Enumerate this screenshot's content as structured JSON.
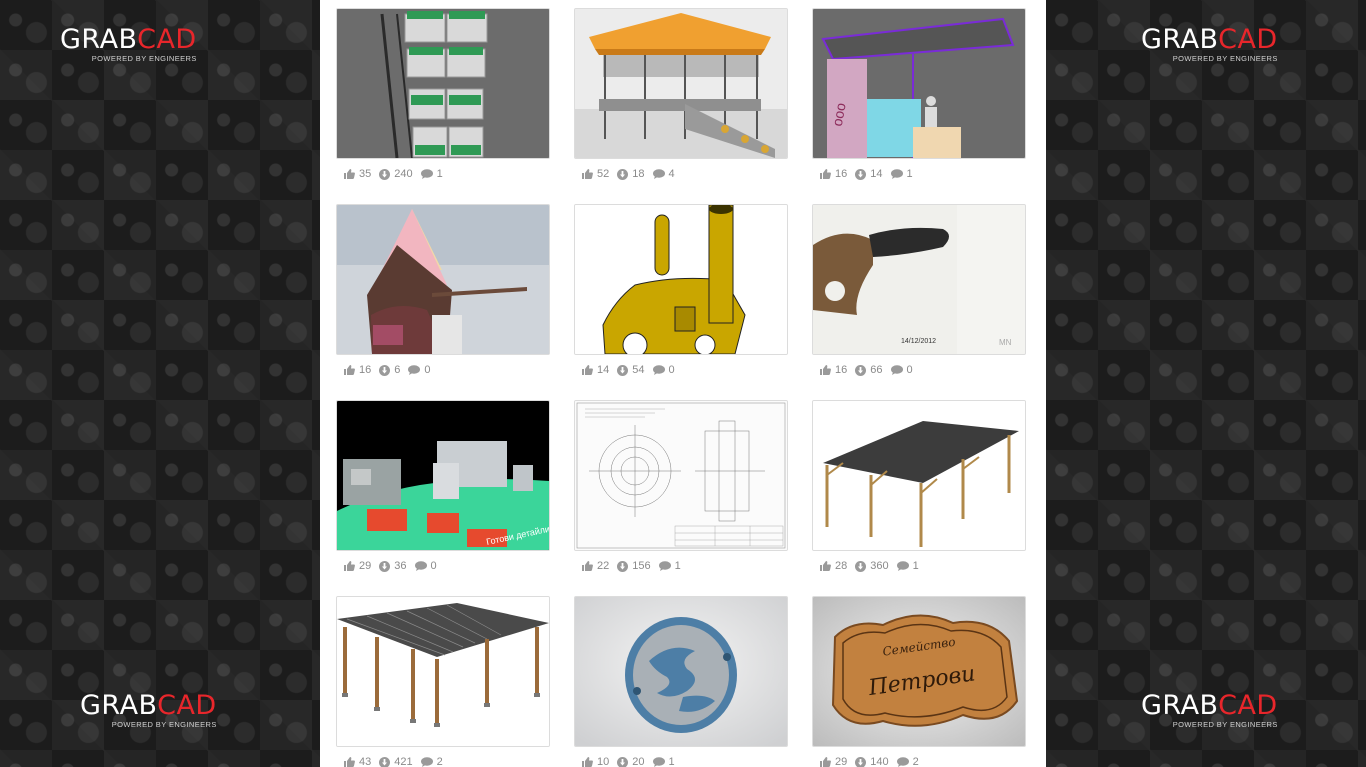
{
  "brand": {
    "word_main": "GRAB",
    "word_accent": "CAD",
    "tagline": "POWERED BY ENGINEERS",
    "accent_color": "#e8262b"
  },
  "models": [
    {
      "subject": "shelf-display-rack",
      "likes": "35",
      "downloads": "240",
      "comments": "1"
    },
    {
      "subject": "gazebo",
      "likes": "52",
      "downloads": "18",
      "comments": "4"
    },
    {
      "subject": "kiosk-stand",
      "likes": "16",
      "downloads": "14",
      "comments": "1"
    },
    {
      "subject": "ice-cream-kiosk",
      "likes": "16",
      "downloads": "6",
      "comments": "0"
    },
    {
      "subject": "mechanical-bracket",
      "likes": "14",
      "downloads": "54",
      "comments": "0"
    },
    {
      "subject": "knife",
      "likes": "16",
      "downloads": "66",
      "comments": "0",
      "photo_date": "14/12/2012",
      "watermark": "MN"
    },
    {
      "subject": "machine-shop-layout",
      "likes": "29",
      "downloads": "36",
      "comments": "0",
      "sign_text": "Готови детайли"
    },
    {
      "subject": "technical-drawing",
      "likes": "22",
      "downloads": "156",
      "comments": "1"
    },
    {
      "subject": "canopy-frame",
      "likes": "28",
      "downloads": "360",
      "comments": "1"
    },
    {
      "subject": "wooden-carport",
      "likes": "43",
      "downloads": "421",
      "comments": "2"
    },
    {
      "subject": "round-emblem",
      "likes": "10",
      "downloads": "20",
      "comments": "1"
    },
    {
      "subject": "wooden-name-plate",
      "likes": "29",
      "downloads": "140",
      "comments": "2",
      "plate_line1": "Семейство",
      "plate_line2": "Петрови"
    }
  ],
  "icons": {
    "likes": "thumbs-up-icon",
    "downloads": "download-icon",
    "comments": "comment-icon"
  }
}
